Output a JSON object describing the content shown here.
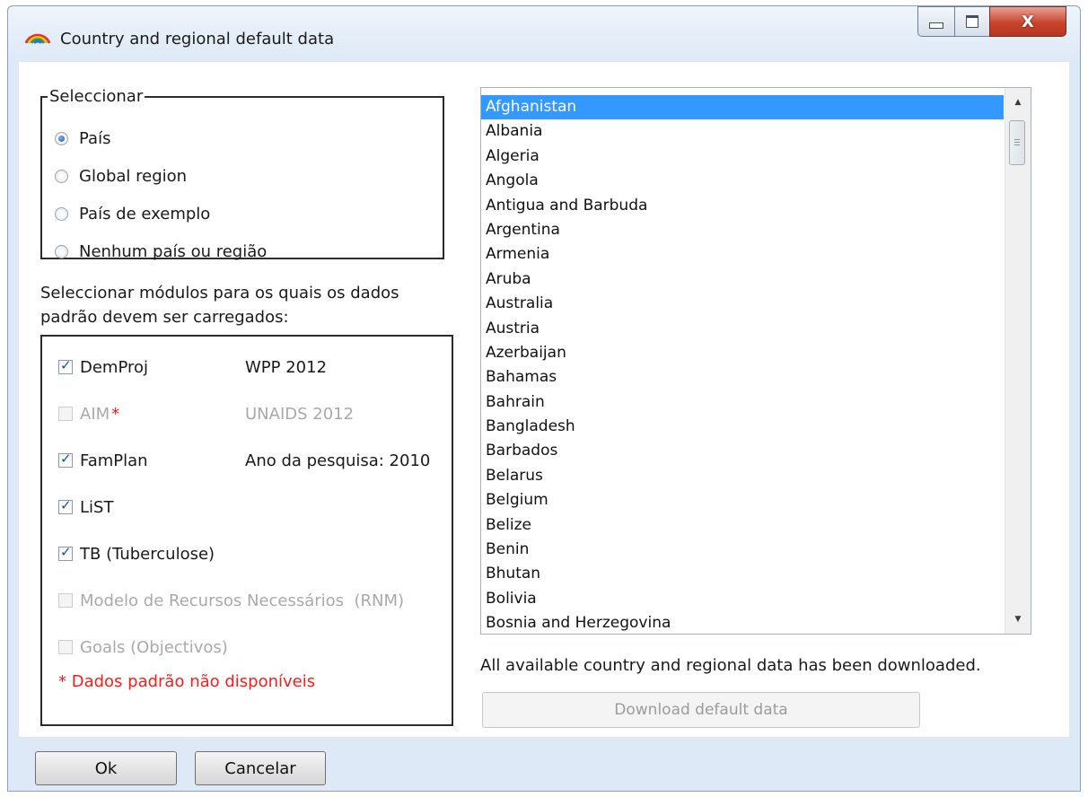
{
  "window": {
    "title": "Country and regional default data",
    "controls": {
      "minimize": "minimize",
      "maximize": "maximize",
      "close": "X"
    }
  },
  "select_group": {
    "legend": "Seleccionar",
    "options": [
      {
        "label": "País",
        "checked": true
      },
      {
        "label": "Global region",
        "checked": false
      },
      {
        "label": "País de exemplo",
        "checked": false
      },
      {
        "label": "Nenhum país ou região",
        "checked": false
      }
    ]
  },
  "modules": {
    "label": "Seleccionar módulos para os quais os dados padrão devem ser carregados:",
    "items": [
      {
        "name": "DemProj",
        "info": "WPP 2012",
        "checked": true,
        "enabled": true,
        "required_marker": ""
      },
      {
        "name": "AIM",
        "info": "UNAIDS 2012",
        "checked": false,
        "enabled": false,
        "required_marker": "*"
      },
      {
        "name": "FamPlan",
        "info": "Ano da pesquisa: 2010",
        "checked": true,
        "enabled": true,
        "required_marker": ""
      },
      {
        "name": "LiST",
        "info": "",
        "checked": true,
        "enabled": true,
        "required_marker": ""
      },
      {
        "name": "TB (Tuberculose)",
        "info": "",
        "checked": true,
        "enabled": true,
        "required_marker": ""
      },
      {
        "name": "Modelo de Recursos Necessários  (RNM)",
        "info": "",
        "checked": false,
        "enabled": false,
        "required_marker": ""
      },
      {
        "name": "Goals (Objectivos)",
        "info": "",
        "checked": false,
        "enabled": false,
        "required_marker": ""
      }
    ],
    "footnote": "* Dados padrão não disponíveis"
  },
  "country_list": {
    "selected": "Afghanistan",
    "items": [
      "Afghanistan",
      "Albania",
      "Algeria",
      "Angola",
      "Antigua and Barbuda",
      "Argentina",
      "Armenia",
      "Aruba",
      "Australia",
      "Austria",
      "Azerbaijan",
      "Bahamas",
      "Bahrain",
      "Bangladesh",
      "Barbados",
      "Belarus",
      "Belgium",
      "Belize",
      "Benin",
      "Bhutan",
      "Bolivia",
      "Bosnia and Herzegovina"
    ]
  },
  "status_text": "All available country and regional data has been downloaded.",
  "download_button": "Download default data",
  "buttons": {
    "ok": "Ok",
    "cancel": "Cancelar"
  },
  "colors": {
    "selection": "#3399ff",
    "required_marker": "#e02020",
    "footnote": "#ff1a1a",
    "disabled_text": "#a9a9a9"
  }
}
